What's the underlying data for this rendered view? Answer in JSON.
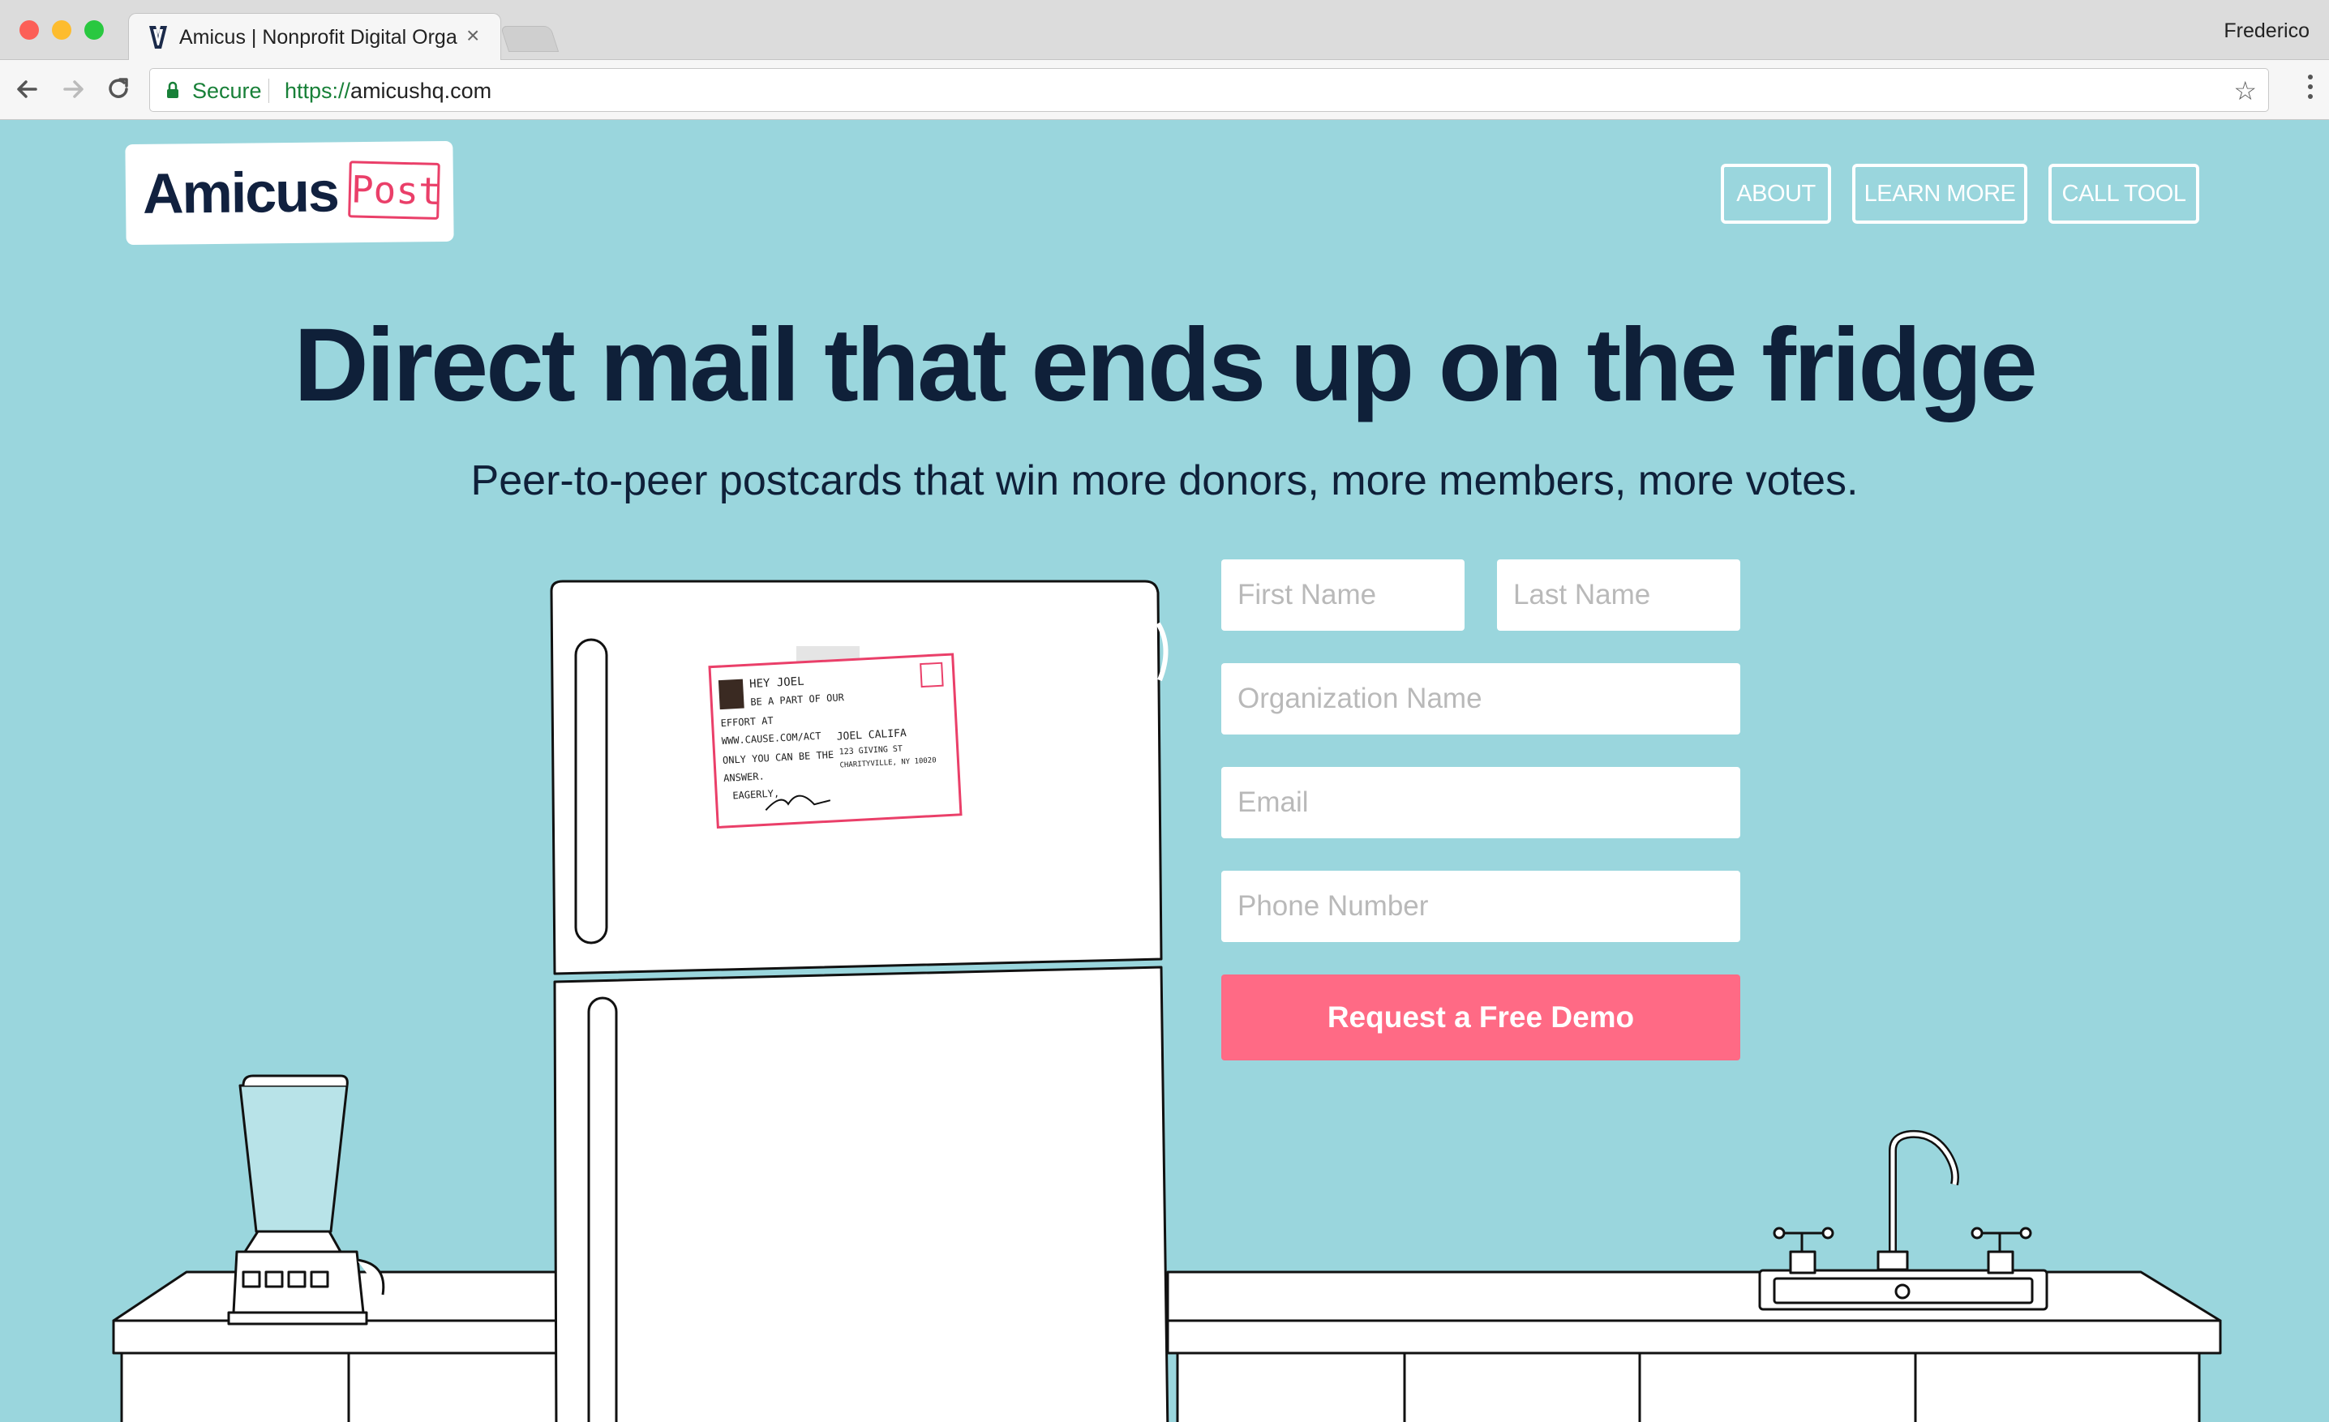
{
  "browser": {
    "tab_title": "Amicus | Nonprofit Digital Orga",
    "profile_name": "Frederico",
    "secure_label": "Secure",
    "url_scheme": "https://",
    "url_host": "amicushq.com"
  },
  "header": {
    "logo_text": "Amicus",
    "logo_tag": "Post",
    "nav": [
      {
        "label": "ABOUT"
      },
      {
        "label": "LEARN MORE"
      },
      {
        "label": "CALL TOOL"
      }
    ]
  },
  "hero": {
    "headline": "Direct mail that ends up on the fridge",
    "subheadline": "Peer-to-peer postcards that win more donors, more members, more votes."
  },
  "form": {
    "first_name_placeholder": "First Name",
    "last_name_placeholder": "Last Name",
    "organization_placeholder": "Organization Name",
    "email_placeholder": "Email",
    "phone_placeholder": "Phone Number",
    "submit_label": "Request a Free Demo"
  },
  "postcard": {
    "line1": "HEY JOEL",
    "line2": "BE A PART OF OUR",
    "line3": "EFFORT AT",
    "line4": "WWW.CAUSE.COM/ACT",
    "line5": "ONLY YOU CAN BE THE",
    "line6": "ANSWER.",
    "line7": "EAGERLY,",
    "addr1": "JOEL CALIFA",
    "addr2": "123 GIVING ST",
    "addr3": "CHARITYVILLE, NY 10020"
  },
  "colors": {
    "background": "#9ad6dd",
    "headline": "#0f2039",
    "accent": "#ff6a85",
    "logo_pink": "#ea3f69"
  }
}
